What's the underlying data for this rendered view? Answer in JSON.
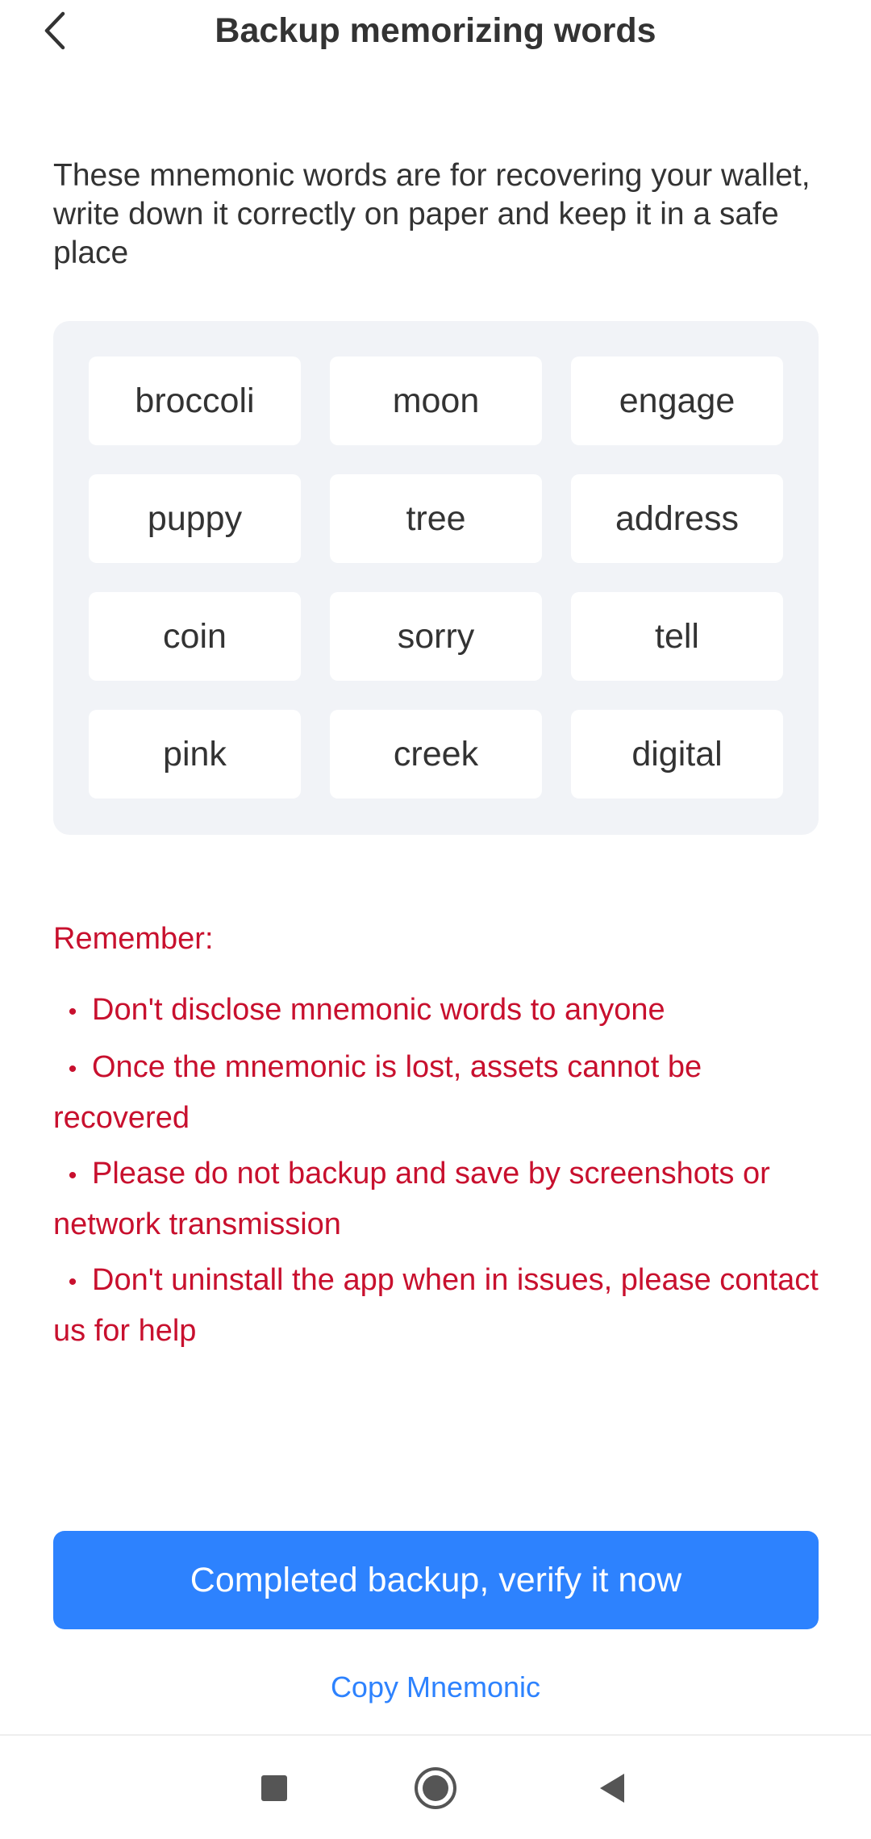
{
  "header": {
    "title": "Backup memorizing words",
    "back_icon": "chevron-left-icon"
  },
  "intro": "These mnemonic words are for recovering your wallet, write down it correctly on paper and keep it in a safe place",
  "mnemonic": {
    "words": [
      "broccoli",
      "moon",
      "engage",
      "puppy",
      "tree",
      "address",
      "coin",
      "sorry",
      "tell",
      "pink",
      "creek",
      "digital"
    ]
  },
  "reminders": {
    "title": "Remember:",
    "bullet": "•",
    "items": [
      "Don't disclose mnemonic words to anyone",
      "Once the mnemonic is lost, assets cannot be recovered",
      "Please do not backup and save by screenshots or network transmission",
      "Don't uninstall the app when in issues, please contact us for help"
    ]
  },
  "actions": {
    "verify_label": "Completed backup, verify it now",
    "copy_label": "Copy Mnemonic"
  },
  "navbar": {
    "items": [
      "recent-apps-icon",
      "home-icon",
      "back-icon"
    ]
  },
  "colors": {
    "accent": "#2d82fe",
    "warning": "#c8102e",
    "text": "#333333",
    "panel": "#f1f3f7"
  }
}
